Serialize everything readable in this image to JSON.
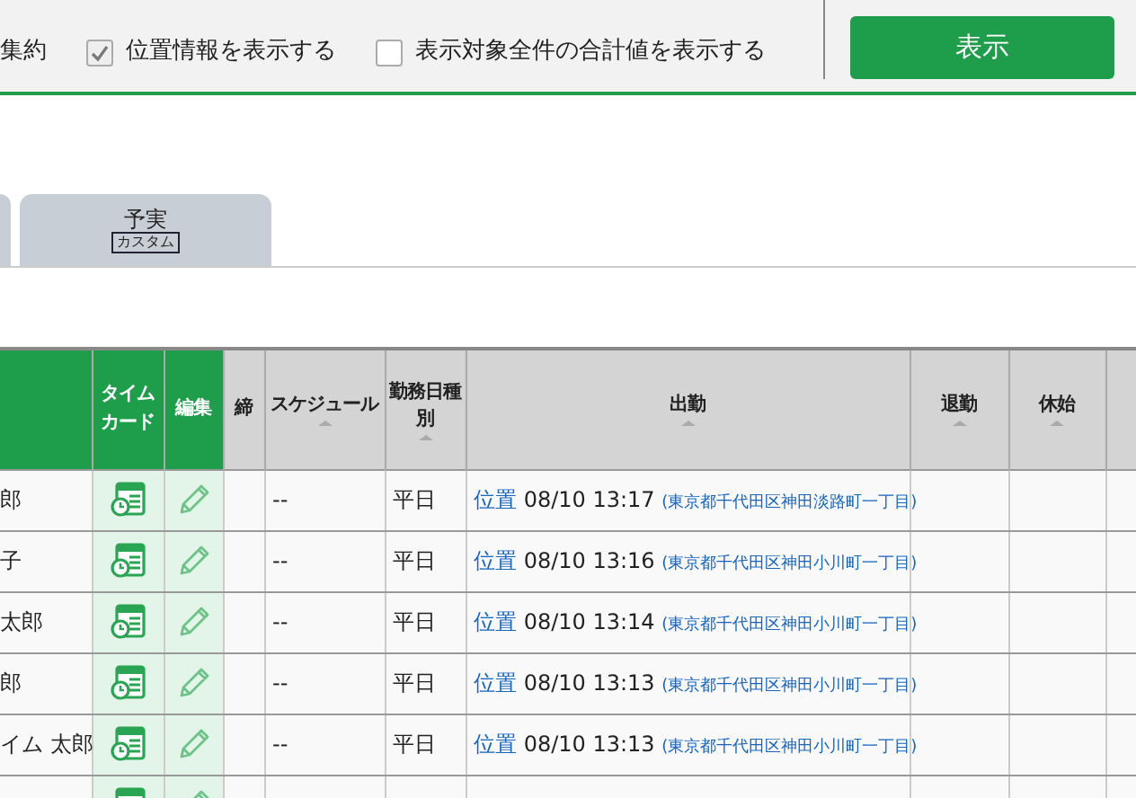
{
  "toolbar": {
    "options": [
      {
        "kind": "text",
        "label": "集約"
      },
      {
        "kind": "checkbox",
        "label": "位置情報を表示する",
        "checked": true
      },
      {
        "kind": "checkbox",
        "label": "表示対象全件の合計値を表示する",
        "checked": false
      }
    ],
    "button": "表示"
  },
  "tabs": [
    {
      "selected": false
    },
    {
      "label": "予実",
      "badge": "カスタム",
      "selected": false
    }
  ],
  "table": {
    "columns": [
      {
        "kind": "accent"
      },
      {
        "kind": "accent",
        "label": "タイムカード"
      },
      {
        "kind": "accent",
        "label": "編集"
      },
      {
        "kind": "plain",
        "label": "締"
      },
      {
        "kind": "plain",
        "label": "スケジュール",
        "sortable": true
      },
      {
        "kind": "plain",
        "label": "勤務日種別",
        "sortable": true
      },
      {
        "kind": "plain",
        "label": "出勤",
        "sortable": true
      },
      {
        "kind": "plain",
        "label": "退勤",
        "sortable": true
      },
      {
        "kind": "plain",
        "label": "休始",
        "sortable": true
      },
      {
        "kind": "plain"
      }
    ],
    "rows": [
      {
        "name": "郎",
        "schedule": "--",
        "day_type": "平日",
        "clock_in": {
          "link": "位置",
          "time": "08/10 13:17",
          "address": "(東京都千代田区神田淡路町一丁目)"
        }
      },
      {
        "name": "子",
        "schedule": "--",
        "day_type": "平日",
        "clock_in": {
          "link": "位置",
          "time": "08/10 13:16",
          "address": "(東京都千代田区神田小川町一丁目)"
        }
      },
      {
        "name": "太郎",
        "schedule": "--",
        "day_type": "平日",
        "clock_in": {
          "link": "位置",
          "time": "08/10 13:14",
          "address": "(東京都千代田区神田小川町一丁目)"
        }
      },
      {
        "name": "郎",
        "schedule": "--",
        "day_type": "平日",
        "clock_in": {
          "link": "位置",
          "time": "08/10 13:13",
          "address": "(東京都千代田区神田小川町一丁目)"
        }
      },
      {
        "name": "イム 太郎",
        "schedule": "--",
        "day_type": "平日",
        "clock_in": {
          "link": "位置",
          "time": "08/10 13:13",
          "address": "(東京都千代田区神田小川町一丁目)"
        }
      },
      {}
    ]
  }
}
